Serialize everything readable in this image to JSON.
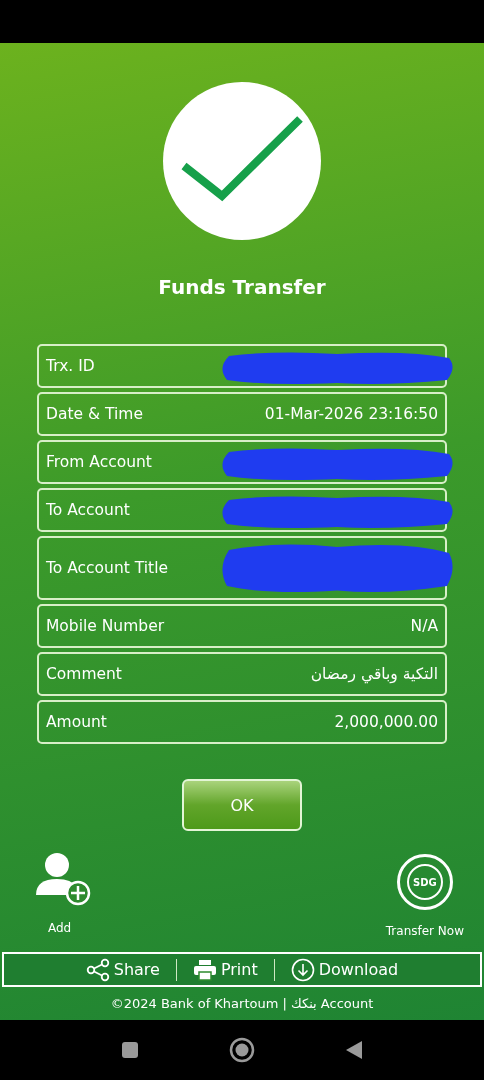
{
  "title": "Funds Transfer",
  "rows": [
    {
      "label": "Trx. ID",
      "kind": "redacted"
    },
    {
      "label": "Date & Time",
      "kind": "text",
      "value": "01-Mar-2026 23:16:50"
    },
    {
      "label": "From Account",
      "kind": "redacted"
    },
    {
      "label": "To Account",
      "kind": "redacted"
    },
    {
      "label": "To Account Title",
      "kind": "redacted",
      "tall": true
    },
    {
      "label": "Mobile Number",
      "kind": "text",
      "value": "N/A"
    },
    {
      "label": "Comment",
      "kind": "text",
      "value": "التكية وباقي رمضان"
    },
    {
      "label": "Amount",
      "kind": "text",
      "value": "2,000,000.00"
    }
  ],
  "ok_button": "OK",
  "shortcuts": {
    "add": "Add",
    "transfer_badge": "SDG",
    "transfer": "Transfer Now"
  },
  "actions": [
    {
      "kind": "share",
      "label": "Share"
    },
    {
      "kind": "print",
      "label": "Print"
    },
    {
      "kind": "download",
      "label": "Download"
    }
  ],
  "footer": "©2024 Bank of Khartoum | بنكك Account"
}
